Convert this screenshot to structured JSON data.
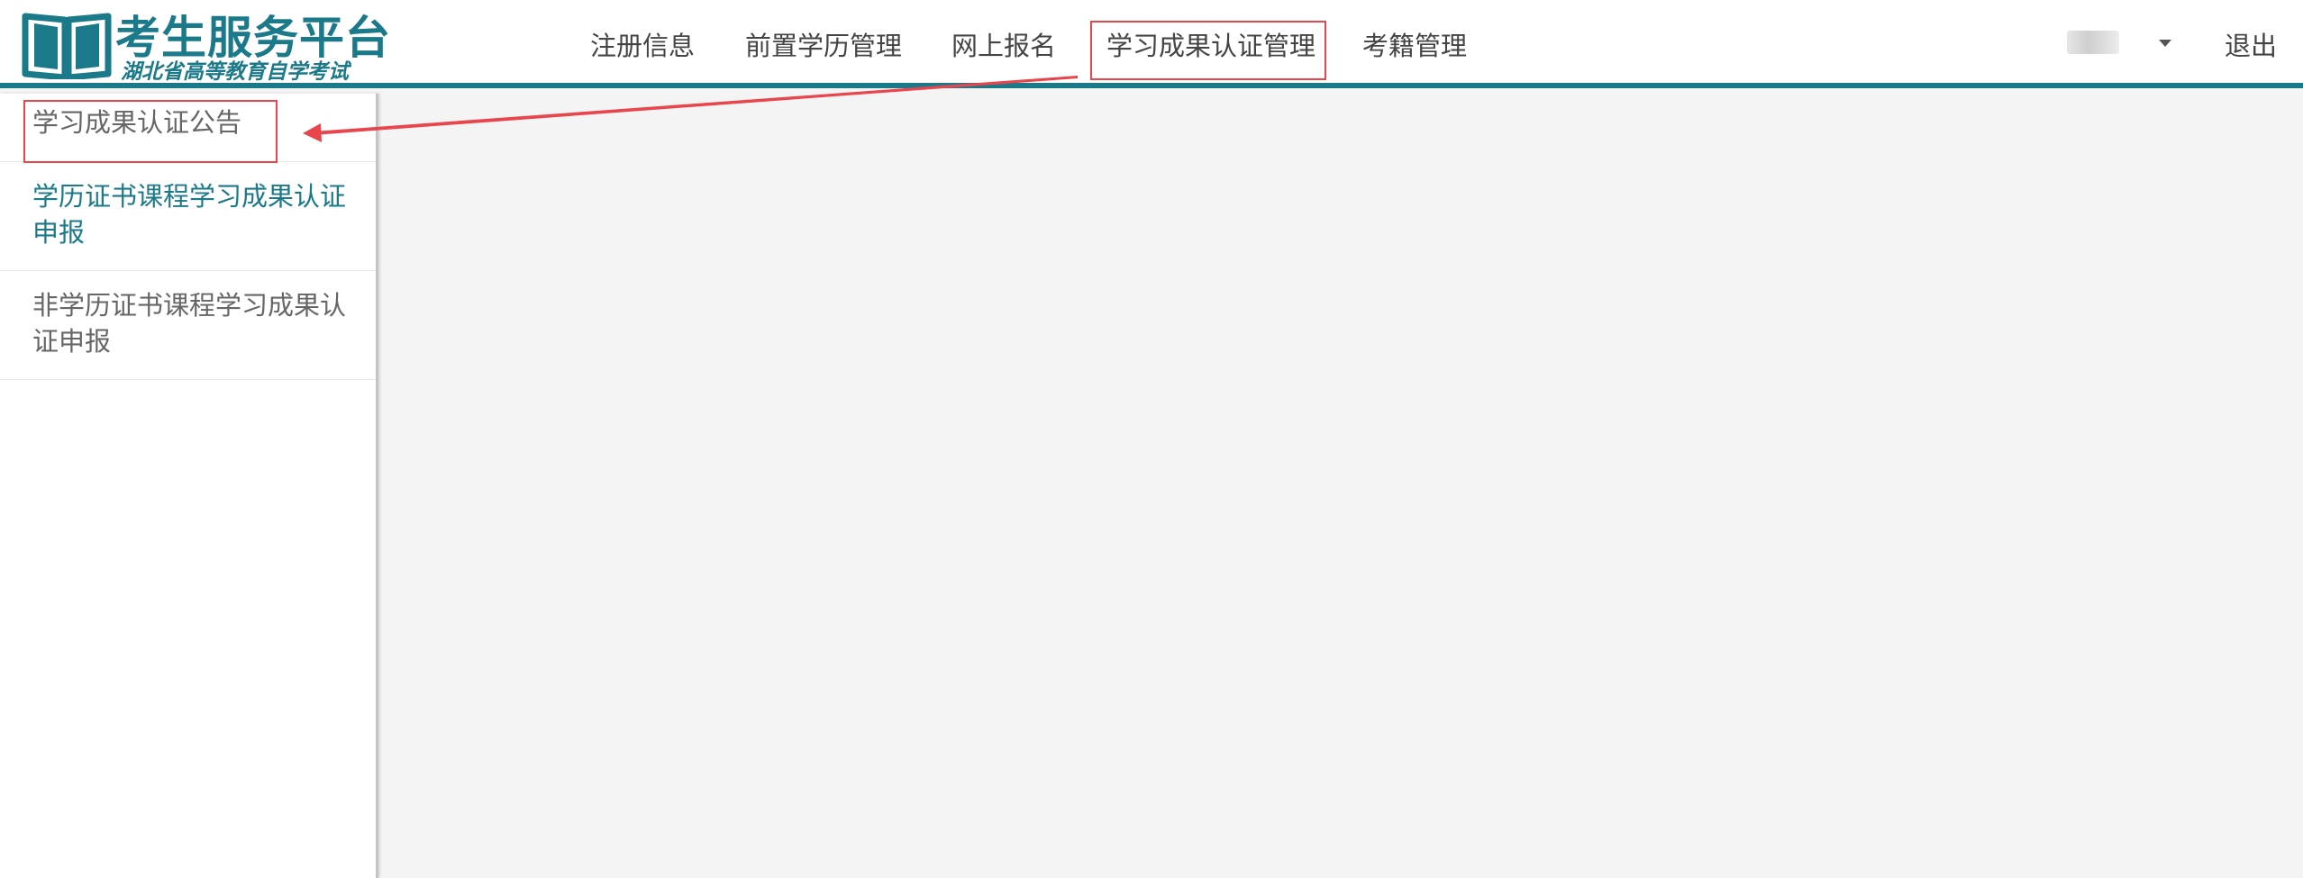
{
  "header": {
    "logo": {
      "title": "考生服务平台",
      "subtitle": "湖北省高等教育自学考试"
    },
    "nav": [
      {
        "label": "注册信息"
      },
      {
        "label": "前置学历管理"
      },
      {
        "label": "网上报名"
      },
      {
        "label": "学习成果认证管理",
        "highlighted": true
      },
      {
        "label": "考籍管理"
      }
    ],
    "logout_label": "退出"
  },
  "sidebar": {
    "items": [
      {
        "label": "学习成果认证公告",
        "highlighted": true
      },
      {
        "label": "学历证书课程学习成果认证申报",
        "active": true
      },
      {
        "label": "非学历证书课程学习成果认证申报"
      }
    ]
  },
  "colors": {
    "brand": "#1b7a8a",
    "highlight_box": "#e8454d",
    "arrow": "#e8454d",
    "active_text": "#1b7a8a",
    "text": "#444444",
    "background": "#f4f4f4"
  }
}
